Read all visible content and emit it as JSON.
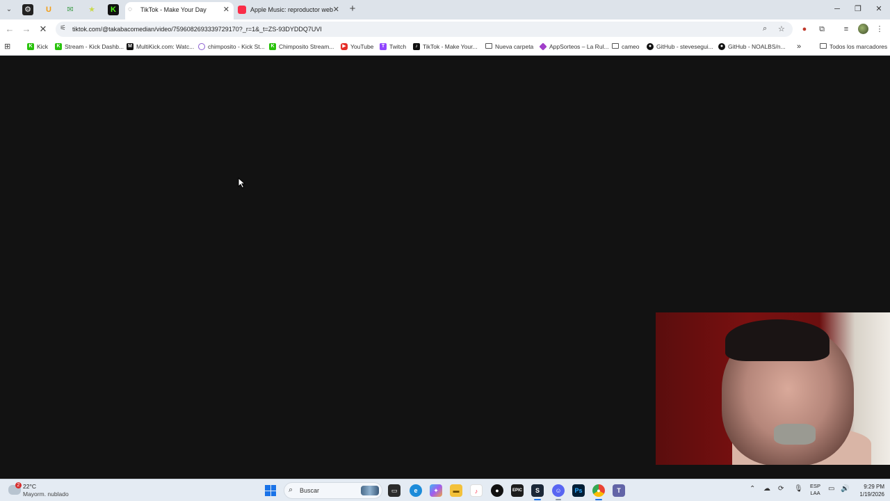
{
  "tabs": [
    {
      "title": "TikTok - Make Your Day",
      "active": true
    },
    {
      "title": "Apple Music: reproductor web",
      "active": false
    }
  ],
  "address_bar": {
    "url": "tiktok.com/@takabacomedian/video/7596082693339729170?_r=1&_t=ZS-93DYDDQ7UVI"
  },
  "bookmarks": [
    {
      "label": "Kick",
      "icon": "kick-icon",
      "color": "#27c20a"
    },
    {
      "label": "Stream - Kick Dashb...",
      "icon": "kick-icon",
      "color": "#27c20a"
    },
    {
      "label": "MultiKick.com: Watc...",
      "icon": "multikick-icon",
      "color": "#111111"
    },
    {
      "label": "chimposito - Kick St...",
      "icon": "loader-icon",
      "color": "#8a5cd1"
    },
    {
      "label": "Chimposito Stream...",
      "icon": "kick-icon",
      "color": "#27c20a"
    },
    {
      "label": "YouTube",
      "icon": "youtube-icon",
      "color": "#e52d27"
    },
    {
      "label": "Twitch",
      "icon": "twitch-icon",
      "color": "#9146ff"
    },
    {
      "label": "TikTok - Make Your...",
      "icon": "tiktok-icon",
      "color": "#111111"
    },
    {
      "label": "Nueva carpeta",
      "icon": "folder-icon",
      "color": ""
    },
    {
      "label": "AppSorteos – La Rul...",
      "icon": "appsorteos-icon",
      "color": "#a03ec9"
    },
    {
      "label": "cameo",
      "icon": "folder-icon",
      "color": ""
    },
    {
      "label": "GitHub - stevesegui...",
      "icon": "github-icon",
      "color": "#111111"
    },
    {
      "label": "GitHub - NOALBS/n...",
      "icon": "github-icon",
      "color": "#111111"
    }
  ],
  "bookmarks_overflow": "»",
  "all_bookmarks": "Todos los marcadores",
  "taskbar": {
    "weather_temp": "22°C",
    "weather_desc": "Mayorm. nublado",
    "weather_badge": "2",
    "search_placeholder": "Buscar",
    "lang_top": "ESP",
    "lang_bottom": "LAA",
    "time": "9:29 PM",
    "date": "1/19/2026"
  },
  "colors": {
    "page_background": "#121212",
    "tabstrip": "#dde3ea",
    "accent": "#1a73e8"
  }
}
